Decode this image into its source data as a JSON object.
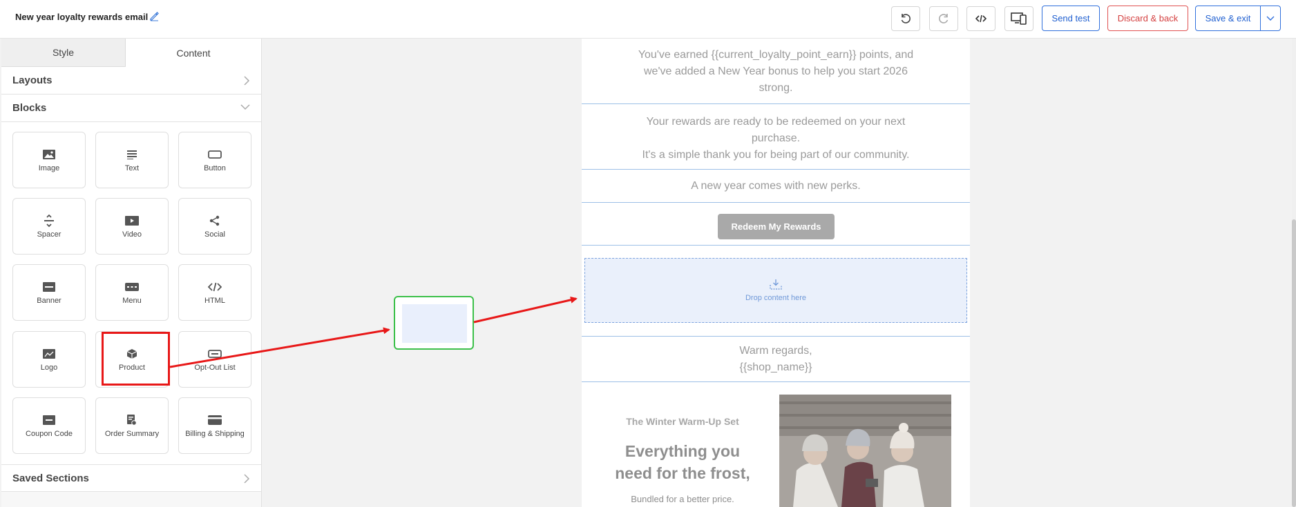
{
  "header": {
    "title": "New year loyalty rewards email",
    "send_test": "Send test",
    "discard": "Discard & back",
    "save_exit": "Save & exit"
  },
  "left_panel": {
    "tabs": [
      "Style",
      "Content"
    ],
    "active_tab": "Content",
    "layouts_label": "Layouts",
    "blocks_label": "Blocks",
    "saved_sections_label": "Saved Sections",
    "blocks": [
      {
        "label": "Image",
        "icon": "image-icon"
      },
      {
        "label": "Text",
        "icon": "text-icon"
      },
      {
        "label": "Button",
        "icon": "button-icon"
      },
      {
        "label": "Spacer",
        "icon": "spacer-icon"
      },
      {
        "label": "Video",
        "icon": "video-icon"
      },
      {
        "label": "Social",
        "icon": "share-icon"
      },
      {
        "label": "Banner",
        "icon": "banner-icon"
      },
      {
        "label": "Menu",
        "icon": "menu-icon"
      },
      {
        "label": "HTML",
        "icon": "code-icon"
      },
      {
        "label": "Logo",
        "icon": "logo-icon"
      },
      {
        "label": "Product",
        "icon": "product-box-icon"
      },
      {
        "label": "Opt-Out List",
        "icon": "opt-out-icon"
      },
      {
        "label": "Coupon Code",
        "icon": "coupon-icon"
      },
      {
        "label": "Order Summary",
        "icon": "order-summary-icon"
      },
      {
        "label": "Billing & Shipping",
        "icon": "billing-card-icon"
      }
    ]
  },
  "email": {
    "para1": [
      "You've earned {{current_loyalty_point_earn}} points, and",
      "we've added a New Year bonus to help you start 2026",
      "strong."
    ],
    "para2": [
      "Your rewards are ready to be redeemed on your next",
      "purchase.",
      "It's a simple thank you for being part of our community."
    ],
    "para3": "A new year comes with new perks.",
    "cta_button": "Redeem My Rewards",
    "drop_text": "Drop content here",
    "signoff": [
      "Warm regards,",
      "{{shop_name}}"
    ],
    "product": {
      "title": "The Winter Warm-Up Set",
      "headline": [
        "Everything you",
        "need for the frost,"
      ],
      "subtext": "Bundled for a better price."
    }
  },
  "colors": {
    "accent_blue": "#1f5fd0",
    "danger_red": "#d43f3f",
    "highlight_red": "#e81818",
    "drag_ghost_green": "#3cc04a",
    "row_divider": "#9cbfe6"
  }
}
